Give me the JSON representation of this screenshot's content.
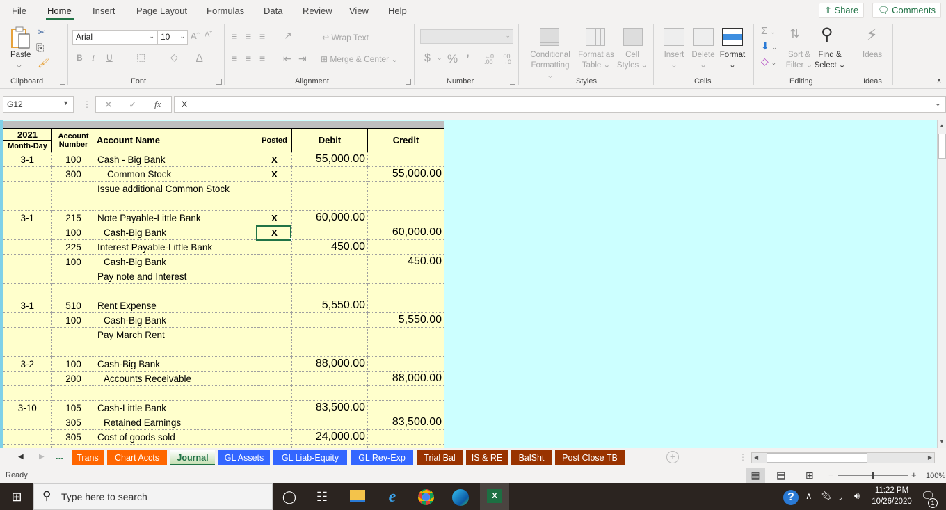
{
  "menu": {
    "items": [
      "File",
      "Home",
      "Insert",
      "Page Layout",
      "Formulas",
      "Data",
      "Review",
      "View",
      "Help"
    ],
    "active": "Home",
    "share": "Share",
    "comments": "Comments"
  },
  "ribbon": {
    "clipboard": {
      "paste": "Paste",
      "label": "Clipboard"
    },
    "font": {
      "name": "Arial",
      "size": "10",
      "label": "Font",
      "bold": "B",
      "italic": "I",
      "underline": "U"
    },
    "alignment": {
      "wrap_text": "Wrap Text",
      "merge_center": "Merge & Center",
      "label": "Alignment"
    },
    "number": {
      "format": "",
      "currency": "$",
      "percent": "%",
      "comma": "9",
      "label": "Number"
    },
    "styles": {
      "conditional": "Conditional",
      "conditional2": "Formatting",
      "format_table": "Format as",
      "format_table2": "Table",
      "cell_styles": "Cell",
      "cell_styles2": "Styles",
      "label": "Styles"
    },
    "cells": {
      "insert": "Insert",
      "delete": "Delete",
      "format": "Format",
      "label": "Cells"
    },
    "editing": {
      "sort": "Sort &",
      "sort2": "Filter",
      "find": "Find &",
      "find2": "Select",
      "label": "Editing"
    },
    "ideas": {
      "button": "Ideas",
      "label": "Ideas"
    }
  },
  "formula_bar": {
    "name_box": "G12",
    "fx": "fx",
    "content": "X"
  },
  "journal": {
    "headers": {
      "year": "2021",
      "month_day": "Month-Day",
      "account": "Account",
      "number": "Number",
      "account_name": "Account Name",
      "posted": "Posted",
      "debit": "Debit",
      "credit": "Credit"
    },
    "rows": [
      {
        "date": "3-1",
        "acct": "100",
        "name": "Cash - Big Bank",
        "indent": 0,
        "posted": "X",
        "debit": "55,000.00",
        "credit": ""
      },
      {
        "date": "",
        "acct": "300",
        "name": "Common Stock",
        "indent": 1,
        "posted": "X",
        "debit": "",
        "credit": "55,000.00"
      },
      {
        "date": "",
        "acct": "",
        "name": "Issue additional Common Stock",
        "indent": 0,
        "posted": "",
        "debit": "",
        "credit": ""
      },
      {
        "date": "",
        "acct": "",
        "name": "",
        "indent": 0,
        "posted": "",
        "debit": "",
        "credit": ""
      },
      {
        "date": "3-1",
        "acct": "215",
        "name": "Note Payable-Little Bank",
        "indent": 0,
        "posted": "X",
        "debit": "60,000.00",
        "credit": ""
      },
      {
        "date": "",
        "acct": "100",
        "name": "Cash-Big Bank",
        "indent": 2,
        "posted": "X",
        "debit": "",
        "credit": "60,000.00"
      },
      {
        "date": "",
        "acct": "225",
        "name": "Interest Payable-Little Bank",
        "indent": 0,
        "posted": "",
        "debit": "450.00",
        "credit": ""
      },
      {
        "date": "",
        "acct": "100",
        "name": "Cash-Big Bank",
        "indent": 2,
        "posted": "",
        "debit": "",
        "credit": "450.00"
      },
      {
        "date": "",
        "acct": "",
        "name": "Pay note and Interest",
        "indent": 0,
        "posted": "",
        "debit": "",
        "credit": ""
      },
      {
        "date": "",
        "acct": "",
        "name": "",
        "indent": 0,
        "posted": "",
        "debit": "",
        "credit": ""
      },
      {
        "date": "3-1",
        "acct": "510",
        "name": "Rent Expense",
        "indent": 0,
        "posted": "",
        "debit": "5,550.00",
        "credit": ""
      },
      {
        "date": "",
        "acct": "100",
        "name": "Cash-Big Bank",
        "indent": 2,
        "posted": "",
        "debit": "",
        "credit": "5,550.00"
      },
      {
        "date": "",
        "acct": "",
        "name": "Pay March Rent",
        "indent": 0,
        "posted": "",
        "debit": "",
        "credit": ""
      },
      {
        "date": "",
        "acct": "",
        "name": "",
        "indent": 0,
        "posted": "",
        "debit": "",
        "credit": ""
      },
      {
        "date": "3-2",
        "acct": "100",
        "name": "Cash-Big Bank",
        "indent": 0,
        "posted": "",
        "debit": "88,000.00",
        "credit": ""
      },
      {
        "date": "",
        "acct": "200",
        "name": "Accounts Receivable",
        "indent": 2,
        "posted": "",
        "debit": "",
        "credit": "88,000.00"
      },
      {
        "date": "",
        "acct": "",
        "name": "",
        "indent": 0,
        "posted": "",
        "debit": "",
        "credit": ""
      },
      {
        "date": "3-10",
        "acct": "105",
        "name": "Cash-Little Bank",
        "indent": 0,
        "posted": "",
        "debit": "83,500.00",
        "credit": ""
      },
      {
        "date": "",
        "acct": "305",
        "name": "Retained Earnings",
        "indent": 2,
        "posted": "",
        "debit": "",
        "credit": "83,500.00"
      },
      {
        "date": "",
        "acct": "305",
        "name": "Cost of goods sold",
        "indent": 0,
        "posted": "",
        "debit": "24,000.00",
        "credit": ""
      },
      {
        "date": "",
        "acct": "",
        "name": "",
        "indent": 0,
        "posted": "",
        "debit": "",
        "credit": ""
      }
    ]
  },
  "sheet_tabs": {
    "ellipsis": "...",
    "tabs": [
      {
        "label": "Trans",
        "color": "#ff6600"
      },
      {
        "label": "Chart Accts",
        "color": "#ff6600"
      },
      {
        "label": "Journal",
        "color": "#c6e0b4",
        "active": true
      },
      {
        "label": "GL Assets",
        "color": "#3366ff"
      },
      {
        "label": "GL Liab-Equity",
        "color": "#3366ff"
      },
      {
        "label": "GL Rev-Exp",
        "color": "#3366ff"
      },
      {
        "label": "Trial Bal",
        "color": "#993300"
      },
      {
        "label": "IS & RE",
        "color": "#993300"
      },
      {
        "label": "BalSht",
        "color": "#993300"
      },
      {
        "label": "Post Close TB",
        "color": "#993300"
      }
    ]
  },
  "status": {
    "mode": "Ready",
    "zoom": "100%",
    "zoom_level": 100
  },
  "taskbar": {
    "search_placeholder": "Type here to search",
    "time": "11:22 PM",
    "date": "10/26/2020",
    "notifications": "1"
  }
}
